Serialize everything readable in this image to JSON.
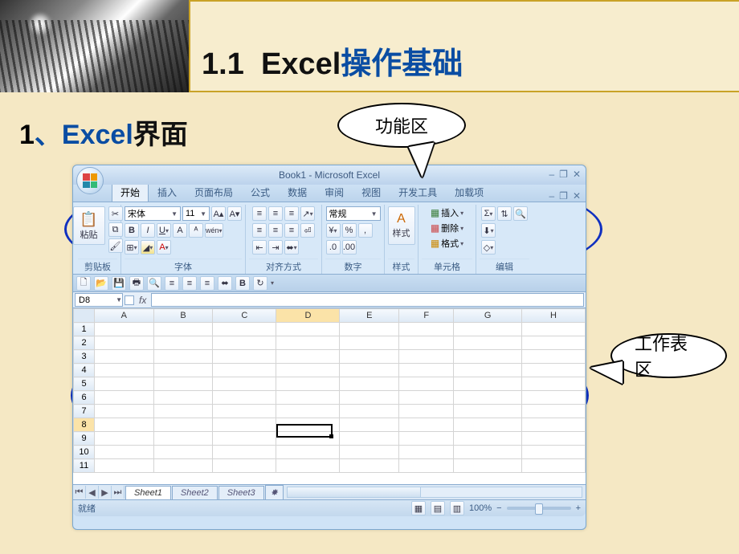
{
  "slide": {
    "heading_num": "1.1",
    "heading_en": "Excel",
    "heading_cn": "操作基础",
    "section_num": "1",
    "section_punct": "、",
    "section_en": "Excel",
    "section_cn": "界面"
  },
  "callouts": {
    "ribbon": "功能区",
    "sheet": "工作表区"
  },
  "excel": {
    "title": "Book1 - Microsoft Excel",
    "window_controls": {
      "min": "–",
      "restore": "❐",
      "close": "✕"
    },
    "doc_controls": {
      "min": "–",
      "restore": "❐",
      "close": "✕"
    },
    "tabs": [
      "开始",
      "插入",
      "页面布局",
      "公式",
      "数据",
      "审阅",
      "视图",
      "开发工具",
      "加载项"
    ],
    "active_tab": 0,
    "clipboard": {
      "paste": "粘贴",
      "label": "剪贴板"
    },
    "font": {
      "name": "宋体",
      "size": "11",
      "label": "字体",
      "buttons": {
        "bold": "B",
        "italic": "I",
        "underline": "U",
        "border": "⊞",
        "fill": "◢",
        "color": "A",
        "grow": "A",
        "shrink": "A",
        "phonetic": "wén"
      }
    },
    "alignment": {
      "label": "对齐方式"
    },
    "number": {
      "format": "常规",
      "label": "数字",
      "percent": "%",
      "comma": ",",
      "inc": ".0",
      "dec": ".00",
      "currency": "¥"
    },
    "styles": {
      "label": "样式",
      "btn": "样式"
    },
    "cells": {
      "insert": "插入",
      "delete": "删除",
      "format": "格式",
      "label": "单元格"
    },
    "editing": {
      "sigma": "Σ",
      "fill": "⬇",
      "clear": "◇",
      "sort": "⇅",
      "find": "🔍",
      "label": "编辑"
    },
    "namebox": "D8",
    "fx": "fx",
    "columns": [
      "A",
      "B",
      "C",
      "D",
      "E",
      "F",
      "G",
      "H"
    ],
    "rows": [
      "1",
      "2",
      "3",
      "4",
      "5",
      "6",
      "7",
      "8",
      "9",
      "10",
      "11"
    ],
    "active_cell": {
      "col": 3,
      "row": 7
    },
    "sheets": [
      "Sheet1",
      "Sheet2",
      "Sheet3"
    ],
    "active_sheet": 0,
    "status": "就绪",
    "zoom": "100%",
    "nav": {
      "first": "⏮",
      "prev": "◀",
      "next": "▶",
      "last": "⏭"
    }
  }
}
